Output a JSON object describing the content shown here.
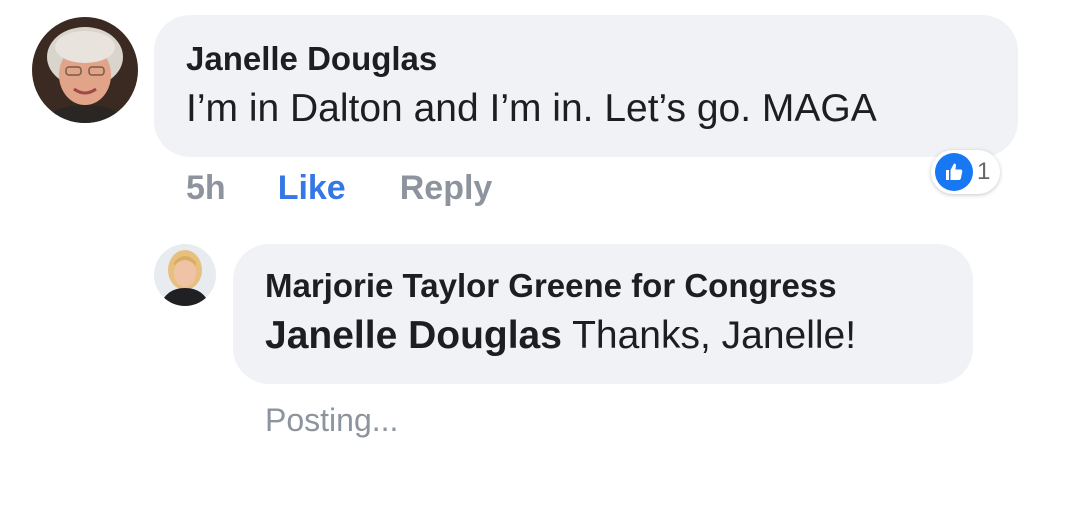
{
  "comment": {
    "author": "Janelle Douglas",
    "text": "I’m in Dalton and I’m in. Let’s go. MAGA",
    "timestamp": "5h",
    "like_label": "Like",
    "reply_label": "Reply",
    "reaction": {
      "icon": "thumbs-up-icon",
      "count": "1",
      "color": "#1877f2"
    }
  },
  "reply": {
    "author": "Marjorie Taylor Greene for Congress",
    "mention": "Janelle Douglas",
    "text": " Thanks, Janelle!",
    "status": "Posting..."
  },
  "colors": {
    "bubble": "#f0f2f5",
    "link_active": "#3578e5",
    "muted": "#8d949e"
  }
}
